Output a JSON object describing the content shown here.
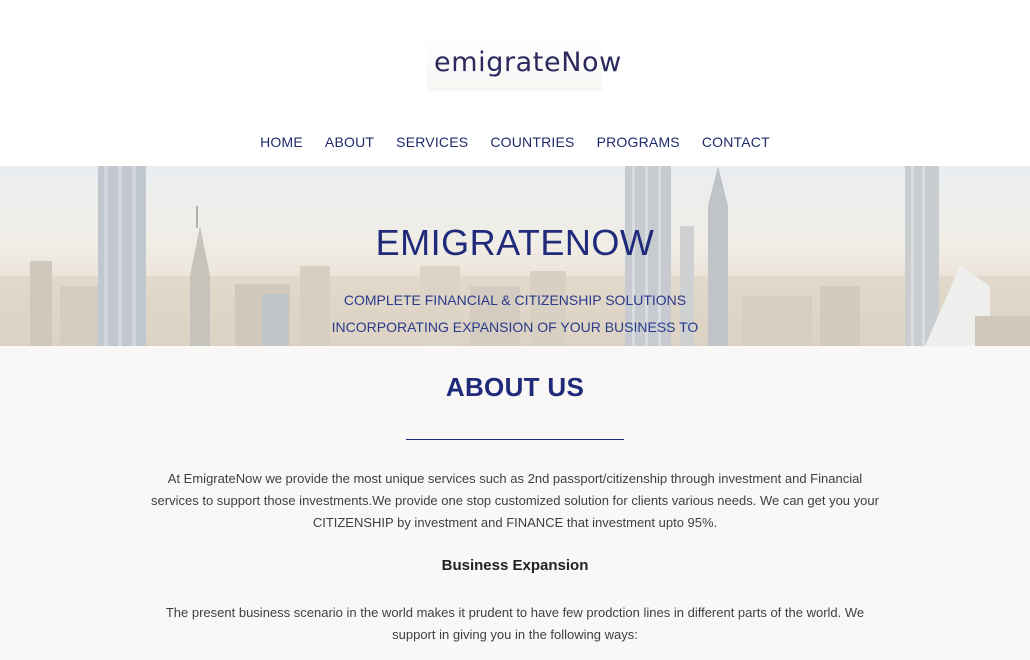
{
  "logo": {
    "text": "emigrateNow",
    "accent_color": "#d8132a"
  },
  "nav": {
    "items": [
      "HOME",
      "ABOUT",
      "SERVICES",
      "COUNTRIES",
      "PROGRAMS",
      "CONTACT"
    ]
  },
  "hero": {
    "title": "EMIGRATENOW",
    "subtitle": "COMPLETE FINANCIAL & CITIZENSHIP SOLUTIONS INCORPORATING EXPANSION OF YOUR BUSINESS TO DEVELOPED COUNTRIES."
  },
  "about": {
    "title": "ABOUT US",
    "paragraph1": "At EmigrateNow we provide the most unique services such as 2nd passport/citizenship through investment and Financial services to support those investments.We provide one stop customized solution for clients various needs. We can get you your CITIZENSHIP by investment and FINANCE that investment upto 95%.",
    "subheading": "Business Expansion",
    "paragraph2": "The present business scenario in the world makes it prudent to have few prodction lines in different parts of the world. We support in giving you in the following ways:"
  },
  "colors": {
    "brand_navy": "#1f2a7a",
    "brand_red": "#d8132a"
  }
}
